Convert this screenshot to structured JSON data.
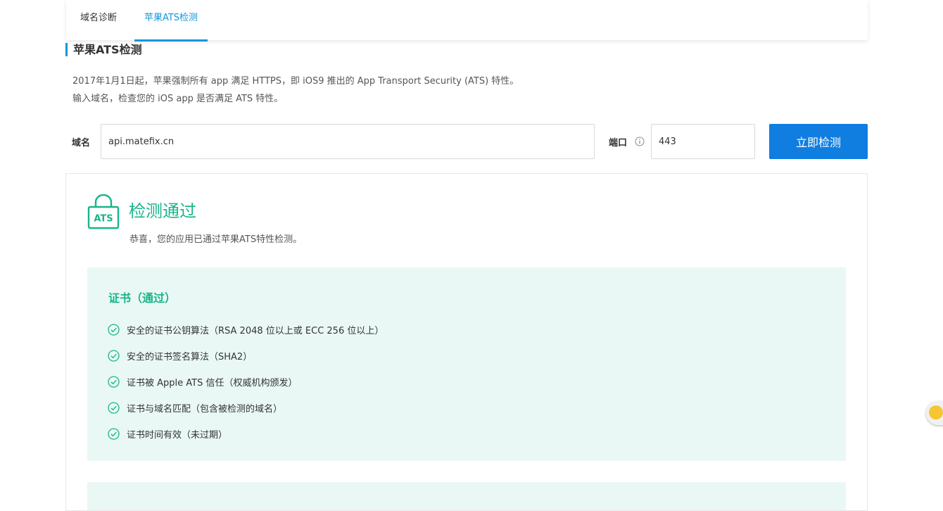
{
  "tabs": [
    {
      "label": "域名诊断",
      "active": false
    },
    {
      "label": "苹果ATS检测",
      "active": true
    }
  ],
  "section_title": "苹果ATS检测",
  "description": {
    "line1": "2017年1月1日起，苹果强制所有 app 满足 HTTPS，即 iOS9 推出的 App Transport Security (ATS) 特性。",
    "line2": "输入域名，检查您的 iOS app 是否满足 ATS 特性。"
  },
  "form": {
    "domain_label": "域名",
    "domain_value": "api.matefix.cn",
    "port_label": "端口",
    "port_value": "443",
    "submit_label": "立即检测"
  },
  "result": {
    "icon_text": "ATS",
    "title": "检测通过",
    "subtitle": "恭喜，您的应用已通过苹果ATS特性检测。"
  },
  "certificate": {
    "title": "证书（通过）",
    "items": [
      "安全的证书公钥算法（RSA 2048 位以上或 ECC 256 位以上）",
      "安全的证书签名算法（SHA2）",
      "证书被 Apple ATS 信任（权威机构颁发）",
      "证书与域名匹配（包含被检测的域名）",
      "证书时间有效（未过期）"
    ]
  },
  "colors": {
    "accent_blue": "#1296db",
    "button_blue": "#0f7ee0",
    "success_green": "#19b58b",
    "panel_green_bg": "#e9f8f4"
  },
  "icons": {
    "info": "info-circle-icon",
    "ats": "ats-lock-icon",
    "check": "check-circle-icon"
  }
}
